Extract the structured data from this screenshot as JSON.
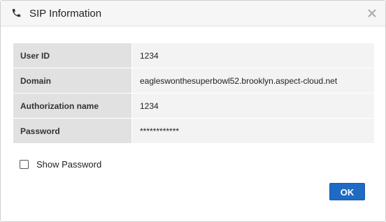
{
  "dialog": {
    "title": "SIP Information",
    "icons": {
      "title_icon": "phone-icon",
      "close": "close-icon"
    }
  },
  "fields": [
    {
      "label": "User ID",
      "value": "1234"
    },
    {
      "label": "Domain",
      "value": "eagleswonthesuperbowl52.brooklyn.aspect-cloud.net"
    },
    {
      "label": "Authorization name",
      "value": "1234"
    },
    {
      "label": "Password",
      "value": "************"
    }
  ],
  "show_password": {
    "label": "Show Password",
    "checked": false
  },
  "buttons": {
    "ok": "OK"
  },
  "colors": {
    "accent": "#1f6bc4",
    "header_bg": "#f6f6f6",
    "label_bg": "#e1e1e1",
    "value_bg": "#f3f3f3"
  }
}
